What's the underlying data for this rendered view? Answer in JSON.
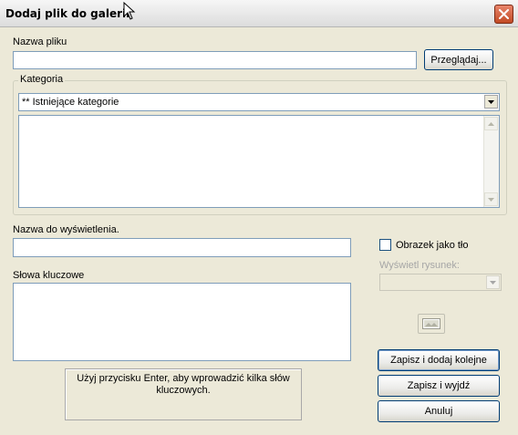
{
  "window": {
    "title": "Dodaj plik do galerii",
    "close_icon": "close-icon",
    "accent": "#003c74"
  },
  "file": {
    "label": "Nazwa pliku",
    "value": "",
    "browse_label": "Przeglądaj..."
  },
  "category": {
    "group_label": "Kategoria",
    "selected": "** Istniejące kategorie",
    "list_items": []
  },
  "display_name": {
    "label": "Nazwa do wyświetlenia.",
    "value": ""
  },
  "keywords": {
    "label": "Słowa kluczowe",
    "value": "",
    "hint": "Użyj przycisku Enter, aby wprowadzić kilka słów kluczowych."
  },
  "background": {
    "checkbox_label": "Obrazek jako tło",
    "checked": false,
    "show_image_label": "Wyświetl rysunek:",
    "show_image_value": "",
    "picture_icon": "picture-icon"
  },
  "actions": {
    "save_next": "Zapisz i dodaj kolejne",
    "save_exit": "Zapisz i wyjdź",
    "cancel": "Anuluj"
  }
}
